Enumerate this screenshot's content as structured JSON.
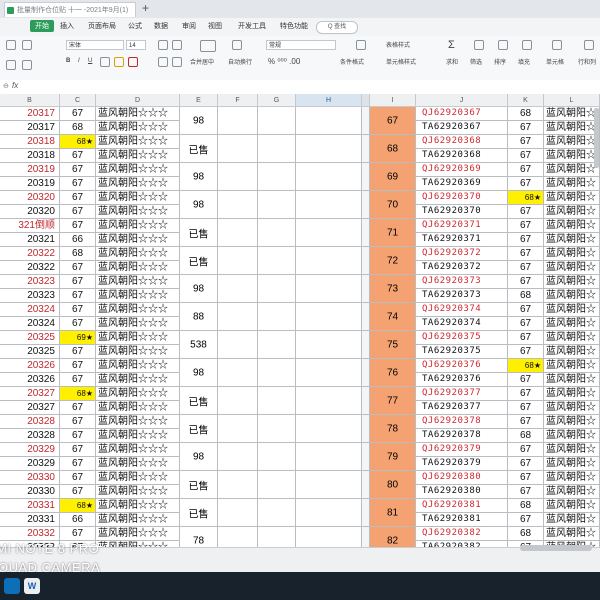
{
  "titlebar": {
    "doc_title": "批量制作仓位贴 十一 -2021年9月(1)",
    "new_tab": "+"
  },
  "menu": {
    "start": "开始",
    "items": [
      "插入",
      "页面布局",
      "公式",
      "数据",
      "审阅",
      "视图",
      "开发工具",
      "特色功能"
    ],
    "search": "Q 查找"
  },
  "toolbar": {
    "font_name": "宋体",
    "font_size": "14",
    "merge": "合并居中",
    "wrap": "自动换行",
    "num_format": "常规",
    "table_style": "表格样式",
    "cond_format": "条件格式",
    "cell_style": "单元格样式",
    "sum": "求和",
    "filter": "筛选",
    "sort": "排序",
    "fill": "填充",
    "cell": "单元格",
    "row_col": "行和列"
  },
  "formula_bar": {
    "fx": "fx"
  },
  "columns": [
    "B",
    "C",
    "D",
    "E",
    "F",
    "G",
    "H",
    "I",
    "J",
    "K",
    "L"
  ],
  "left_rows": [
    {
      "b": "20317",
      "c": "67",
      "b_red": true
    },
    {
      "b": "20317",
      "c": "68",
      "b_red": false
    },
    {
      "b": "20318",
      "c": "68★",
      "b_red": true,
      "c_star": true
    },
    {
      "b": "20318",
      "c": "67",
      "b_red": false
    },
    {
      "b": "20319",
      "c": "67",
      "b_red": true
    },
    {
      "b": "20319",
      "c": "67",
      "b_red": false
    },
    {
      "b": "20320",
      "c": "67",
      "b_red": true
    },
    {
      "b": "20320",
      "c": "67",
      "b_red": false
    },
    {
      "b": "321倒顺",
      "c": "67",
      "b_red": true
    },
    {
      "b": "20321",
      "c": "66",
      "b_red": false
    },
    {
      "b": "20322",
      "c": "68",
      "b_red": true
    },
    {
      "b": "20322",
      "c": "67",
      "b_red": false
    },
    {
      "b": "20323",
      "c": "67",
      "b_red": true
    },
    {
      "b": "20323",
      "c": "67",
      "b_red": false
    },
    {
      "b": "20324",
      "c": "67",
      "b_red": true
    },
    {
      "b": "20324",
      "c": "67",
      "b_red": false
    },
    {
      "b": "20325",
      "c": "69★",
      "b_red": true,
      "c_star": true
    },
    {
      "b": "20325",
      "c": "67",
      "b_red": false
    },
    {
      "b": "20326",
      "c": "67",
      "b_red": true
    },
    {
      "b": "20326",
      "c": "67",
      "b_red": false
    },
    {
      "b": "20327",
      "c": "68★",
      "b_red": true,
      "c_star": true
    },
    {
      "b": "20327",
      "c": "67",
      "b_red": false
    },
    {
      "b": "20328",
      "c": "67",
      "b_red": true
    },
    {
      "b": "20328",
      "c": "67",
      "b_red": false
    },
    {
      "b": "20329",
      "c": "67",
      "b_red": true
    },
    {
      "b": "20329",
      "c": "67",
      "b_red": false
    },
    {
      "b": "20330",
      "c": "67",
      "b_red": true
    },
    {
      "b": "20330",
      "c": "67",
      "b_red": false
    },
    {
      "b": "20331",
      "c": "68★",
      "b_red": true,
      "c_star": true
    },
    {
      "b": "20331",
      "c": "66",
      "b_red": false
    },
    {
      "b": "20332",
      "c": "67",
      "b_red": true
    },
    {
      "b": "20332",
      "c": "67",
      "b_red": false
    }
  ],
  "d_text": "蓝风朝阳☆☆☆",
  "e_groups": [
    "98",
    "已售",
    "98",
    "98",
    "已售",
    "已售",
    "98",
    "88",
    "538",
    "98",
    "已售",
    "已售",
    "98",
    "已售",
    "已售",
    "78"
  ],
  "i_groups": [
    "67",
    "68",
    "69",
    "70",
    "71",
    "72",
    "73",
    "74",
    "75",
    "76",
    "77",
    "78",
    "79",
    "80",
    "81",
    "82"
  ],
  "right_rows": [
    {
      "j": "QJ62920367",
      "k": "68"
    },
    {
      "j": "TA62920367",
      "k": "67"
    },
    {
      "j": "QJ62920368",
      "k": "67"
    },
    {
      "j": "TA62920368",
      "k": "67"
    },
    {
      "j": "QJ62920369",
      "k": "67"
    },
    {
      "j": "TA62920369",
      "k": "67"
    },
    {
      "j": "QJ62920370",
      "k": "68★",
      "k_star": true
    },
    {
      "j": "TA62920370",
      "k": "67"
    },
    {
      "j": "QJ62920371",
      "k": "67"
    },
    {
      "j": "TA62920371",
      "k": "67"
    },
    {
      "j": "QJ62920372",
      "k": "67"
    },
    {
      "j": "TA62920372",
      "k": "67"
    },
    {
      "j": "QJ62920373",
      "k": "67"
    },
    {
      "j": "TA62920373",
      "k": "68"
    },
    {
      "j": "QJ62920374",
      "k": "67"
    },
    {
      "j": "TA62920374",
      "k": "67"
    },
    {
      "j": "QJ62920375",
      "k": "67"
    },
    {
      "j": "TA62920375",
      "k": "67"
    },
    {
      "j": "QJ62920376",
      "k": "68★",
      "k_star": true
    },
    {
      "j": "TA62920376",
      "k": "67"
    },
    {
      "j": "QJ62920377",
      "k": "67"
    },
    {
      "j": "TA62920377",
      "k": "67"
    },
    {
      "j": "QJ62920378",
      "k": "67"
    },
    {
      "j": "TA62920378",
      "k": "68"
    },
    {
      "j": "QJ62920379",
      "k": "67"
    },
    {
      "j": "TA62920379",
      "k": "67"
    },
    {
      "j": "QJ62920380",
      "k": "67"
    },
    {
      "j": "TA62920380",
      "k": "67"
    },
    {
      "j": "QJ62920381",
      "k": "68"
    },
    {
      "j": "TA62920381",
      "k": "67"
    },
    {
      "j": "QJ62920382",
      "k": "68"
    },
    {
      "j": "TA62920382",
      "k": "67"
    }
  ],
  "l_text": "蓝风朝阳☆",
  "watermark": {
    "line1": "MI NOTE 8 PRO",
    "line2": "QUAD CAMERA"
  },
  "colors": {
    "red_text": "#c0282e",
    "orange_fill": "#f4a272",
    "star_fill": "#fff000",
    "accent": "#2d9c5a"
  }
}
